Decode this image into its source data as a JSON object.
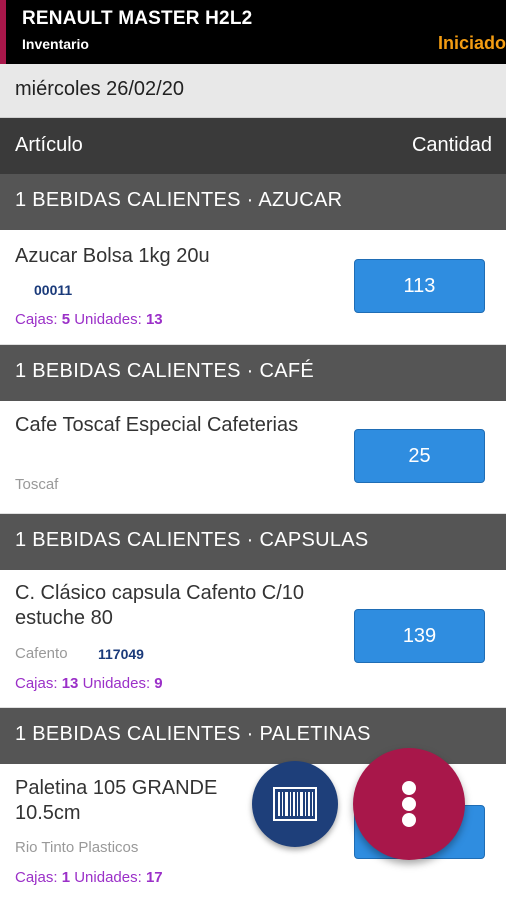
{
  "header": {
    "title": "RENAULT MASTER H2L2",
    "subtitle": "Inventario",
    "status": "Iniciado"
  },
  "date": "miércoles 26/02/20",
  "columns": {
    "article": "Artículo",
    "quantity": "Cantidad"
  },
  "sections": [
    "1 BEBIDAS CALIENTES · AZUCAR",
    "1 BEBIDAS CALIENTES · CAFÉ",
    "1 BEBIDAS CALIENTES · CAPSULAS",
    "1 BEBIDAS CALIENTES · PALETINAS"
  ],
  "items": [
    {
      "name": "Azucar Bolsa 1kg 20u",
      "brand": "",
      "code": "00011",
      "cajas_label": "Cajas:",
      "cajas": "5",
      "unidades_label": "Unidades:",
      "unidades": "13",
      "quantity": "113"
    },
    {
      "name": "Cafe Toscaf Especial Cafeterias",
      "brand": "Toscaf",
      "code": "",
      "quantity": "25"
    },
    {
      "name": "C. Clásico capsula Cafento C/10 estuche 80",
      "brand": "Cafento",
      "code": "117049",
      "cajas_label": "Cajas:",
      "cajas": "13",
      "unidades_label": "Unidades:",
      "unidades": "9",
      "quantity": "139"
    },
    {
      "name": "Paletina 105 GRANDE 10.5cm",
      "brand": "Rio Tinto Plasticos",
      "code": "",
      "cajas_label": "Cajas:",
      "cajas": "1",
      "unidades_label": "Unidades:",
      "unidades": "17",
      "quantity": ""
    }
  ],
  "icons": {
    "barcode": "barcode-icon",
    "more": "more-vertical-icon"
  },
  "colors": {
    "accent": "#a8174a",
    "status": "#f39c12",
    "button": "#2f8de0",
    "counts": "#9b30c8",
    "code": "#1a3a7a",
    "barcode_fab": "#1e3f7a"
  }
}
